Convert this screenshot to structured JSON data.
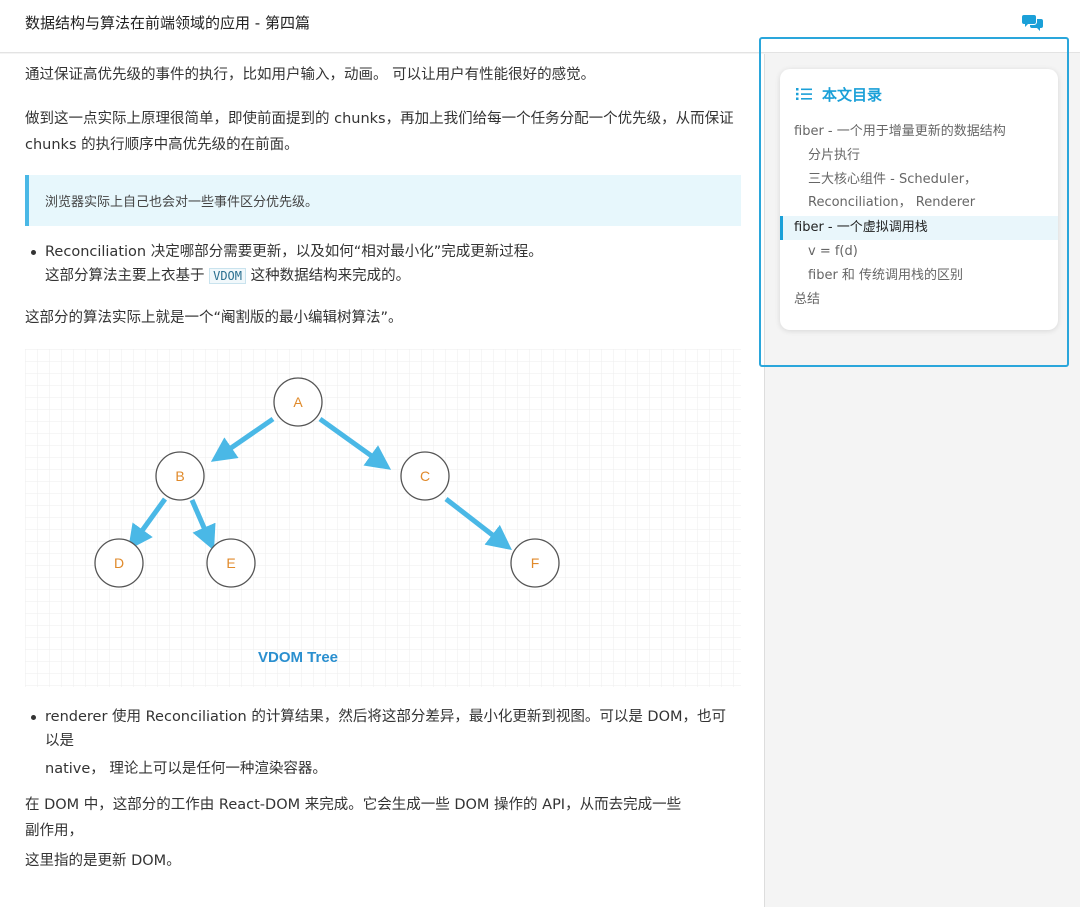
{
  "header": {
    "title": "数据结构与算法在前端领域的应用 - 第四篇",
    "chat_icon": "chat-bubbles-icon"
  },
  "article": {
    "p1": "通过保证高优先级的事件的执行，比如用户输入，动画。 可以让用户有性能很好的感觉。",
    "p2": "做到这一点实际上原理很简单，即使前面提到的 chunks，再加上我们给每一个任务分配一个优先级，从而保证 chunks 的执行顺序中高优先级的在前面。",
    "quote": "浏览器实际上自己也会对一些事件区分优先级。",
    "bullet1_line1": "Reconciliation 决定哪部分需要更新，以及如何“相对最小化”完成更新过程。",
    "bullet1_line2_pre": "这部分算法主要上衣基于",
    "bullet1_code": "VDOM",
    "bullet1_line2_post": "这种数据结构来完成的。",
    "p3": "这部分的算法实际上就是一个“阉割版的最小编辑树算法”。",
    "bullet2_line1": "renderer 使用 Reconciliation 的计算结果，然后将这部分差异，最小化更新到视图。可以是 DOM，也可",
    "bullet2_line2": "以是",
    "bullet2_line3": "native， 理论上可以是任何一种渲染容器。",
    "p4_line1": "在 DOM 中，这部分的工作由 React-DOM 来完成。它会生成一些 DOM 操作的 API，从而去完成一些",
    "p4_line2": "副作用，",
    "p4_line3": "这里指的是更新 DOM。"
  },
  "tree": {
    "label": "VDOM Tree",
    "nodes": [
      "A",
      "B",
      "C",
      "D",
      "E",
      "F"
    ],
    "node_color": "#e08a2b",
    "arrow_color": "#4ab8e6"
  },
  "toc": {
    "title": "本文目录",
    "icon": "list-icon",
    "items": [
      {
        "label": "fiber - 一个用于增量更新的数据结构"
      },
      {
        "label": "分片执行"
      },
      {
        "label": "三大核心组件 - Scheduler，"
      },
      {
        "label": "Reconciliation， Renderer"
      },
      {
        "label": "fiber - 一个虚拟调用栈"
      },
      {
        "label": "v = f(d)"
      },
      {
        "label": "fiber 和 传统调用栈的区别"
      },
      {
        "label": "总结"
      }
    ]
  }
}
